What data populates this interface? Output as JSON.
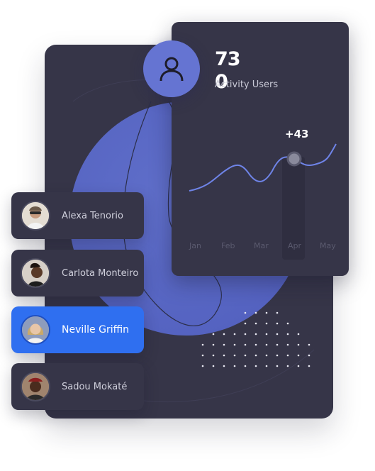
{
  "activity": {
    "count": "73\n0",
    "label": "Activity Users",
    "delta": "+43",
    "months": [
      "Jan",
      "Feb",
      "Mar",
      "Apr",
      "May"
    ],
    "highlight_month": "Apr"
  },
  "users": [
    {
      "name": "Alexa Tenorio",
      "active": false
    },
    {
      "name": "Carlota Monteiro",
      "active": false
    },
    {
      "name": "Neville Griffin",
      "active": true
    },
    {
      "name": "Sadou Mokaté",
      "active": false
    }
  ],
  "colors": {
    "card_bg": "#363548",
    "accent_blue": "#2f6ff0",
    "avatar_blue": "#6574d2",
    "line": "#6f84e8"
  }
}
